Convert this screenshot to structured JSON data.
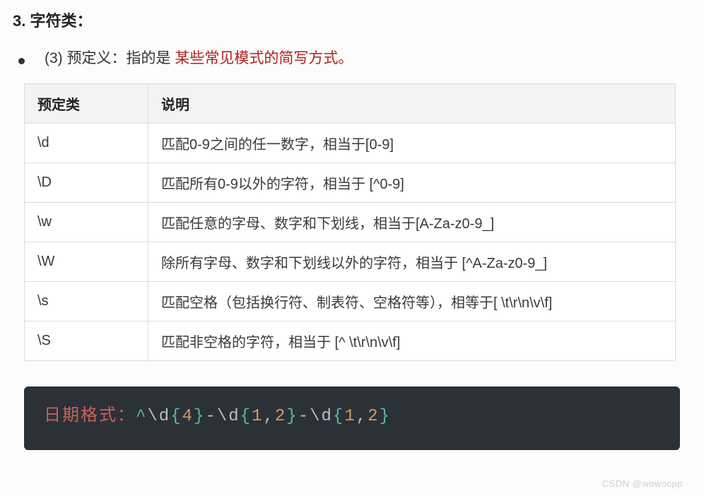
{
  "heading": "3. 字符类：",
  "bullet": {
    "prefix": "(3) 预定义：指的是 ",
    "highlight": "某些常见模式的简写方式。"
  },
  "table": {
    "headers": [
      "预定类",
      "说明"
    ],
    "rows": [
      {
        "class": "\\d",
        "desc": "匹配0-9之间的任一数字，相当于[0-9]"
      },
      {
        "class": "\\D",
        "desc": "匹配所有0-9以外的字符，相当于  [^0-9]"
      },
      {
        "class": "\\w",
        "desc": "匹配任意的字母、数字和下划线，相当于[A-Za-z0-9_]"
      },
      {
        "class": "\\W",
        "desc": "除所有字母、数字和下划线以外的字符，相当于  [^A-Za-z0-9_]"
      },
      {
        "class": "\\s",
        "desc": "匹配空格（包括换行符、制表符、空格符等），相等于[ \\t\\r\\n\\v\\f]"
      },
      {
        "class": "\\S",
        "desc": "匹配非空格的字符，相当于  [^ \\t\\r\\n\\v\\f]"
      }
    ]
  },
  "code": {
    "label": "日期格式：",
    "tokens": [
      {
        "t": "^",
        "c": "teal"
      },
      {
        "t": "\\d",
        "c": "gray"
      },
      {
        "t": "{",
        "c": "teal"
      },
      {
        "t": "4",
        "c": "orange"
      },
      {
        "t": "}",
        "c": "teal"
      },
      {
        "t": "-",
        "c": "gray"
      },
      {
        "t": "\\d",
        "c": "gray"
      },
      {
        "t": "{",
        "c": "teal"
      },
      {
        "t": "1",
        "c": "orange"
      },
      {
        "t": ",",
        "c": "gray"
      },
      {
        "t": "2",
        "c": "orange"
      },
      {
        "t": "}",
        "c": "teal"
      },
      {
        "t": "-",
        "c": "gray"
      },
      {
        "t": "\\d",
        "c": "gray"
      },
      {
        "t": "{",
        "c": "teal"
      },
      {
        "t": "1",
        "c": "orange"
      },
      {
        "t": ",",
        "c": "gray"
      },
      {
        "t": "2",
        "c": "orange"
      },
      {
        "t": "}",
        "c": "teal"
      }
    ]
  },
  "watermark": "CSDN @wowocpp"
}
